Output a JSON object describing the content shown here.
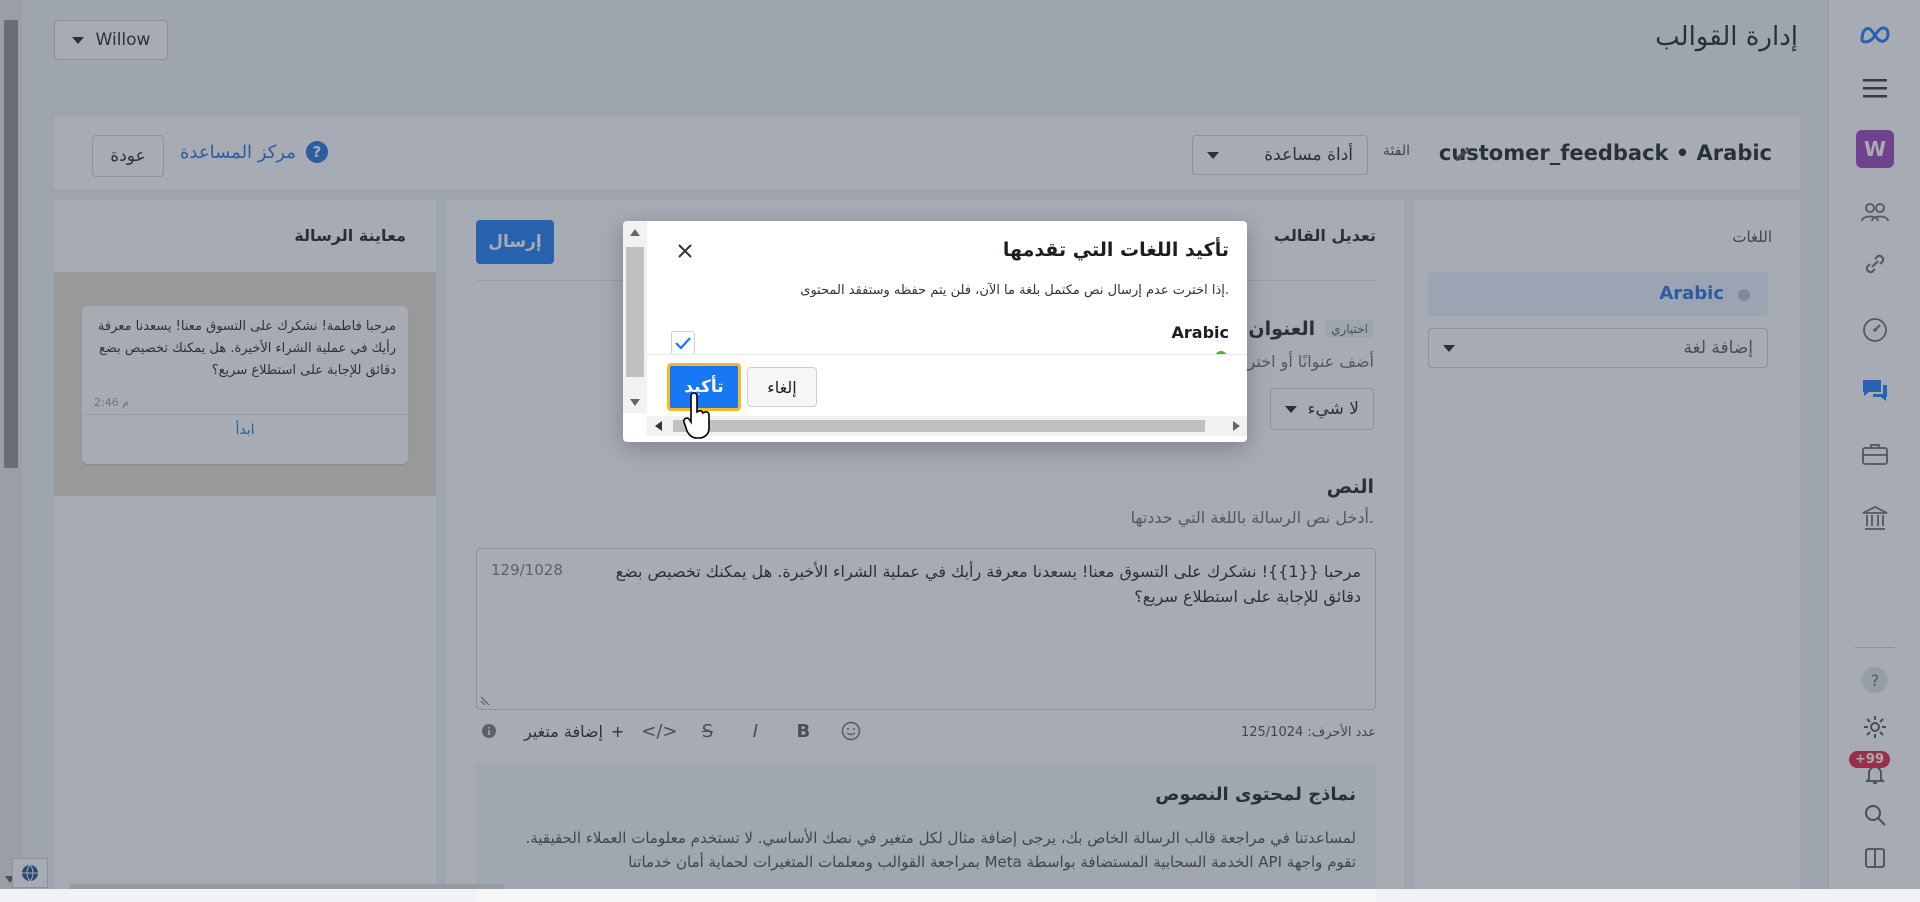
{
  "header": {
    "page_title": "إدارة القوالب",
    "account_name": "Willow"
  },
  "template_bar": {
    "template_name": "customer_feedback • Arabic",
    "category_label": "الفئة",
    "category_value": "أداة مساعدة",
    "help_center": "مركز المساعدة",
    "back": "عودة"
  },
  "languages": {
    "title": "اللغات",
    "selected": "Arabic",
    "add_placeholder": "إضافة لغة"
  },
  "editor": {
    "title": "تعديل القالب",
    "send": "إرسال",
    "header_label": "العنوان",
    "optional": "اختياري",
    "header_sub": "أضف عنوانًا أو اختر",
    "header_type": "لا شيء",
    "body_label": "النص",
    "body_sub": "أدخل نص الرسالة باللغة التي حددتها.",
    "body_text": "مرحبا {{1}}! نشكرك على التسوق معنا! يسعدنا معرفة رأيك في عملية الشراء الأخيرة. هل يمكنك تخصيص بضع دقائق للإجابة على استطلاع سريع؟",
    "body_count": "129/1028",
    "char_count": "عدد الأحرف: 125/1024",
    "add_variable": "إضافة متغير",
    "samples_title": "نماذج لمحتوى النصوص",
    "samples_text": "لمساعدتنا في مراجعة قالب الرسالة الخاص بك، يرجى إضافة مثال لكل متغير في نصك الأساسي. لا تستخدم معلومات العملاء الحقيقية. تقوم واجهة API الخدمة السحابية المستضافة بواسطة Meta بمراجعة القوالب ومعلمات المتغيرات لحماية أمان خدماتنا"
  },
  "preview": {
    "title": "معاينة الرسالة",
    "message": "مرحبا فاطمة! نشكرك على التسوق معنا! يسعدنا معرفة رأيك في عملية الشراء الأخيرة. هل يمكنك تخصيص بضع دقائق للإجابة على استطلاع سريع؟",
    "time": "2:46 م",
    "cta": "ابدأ"
  },
  "dialog": {
    "title": "تأكيد اللغات التي تقدمها",
    "description": "إذا اخترت عدم إرسال نص مكتمل بلغة ما الآن، فلن يتم حفظه وستفقد المحتوى.",
    "language": "Arabic",
    "confirm": "تأكيد",
    "cancel": "إلغاء"
  },
  "rail": {
    "avatar_letter": "W",
    "badge": "+99"
  },
  "icons": {
    "meta": "meta-logo-icon",
    "menu": "hamburger-menu-icon",
    "people": "people-icon",
    "link": "link-icon",
    "gauge": "gauge-icon",
    "chat": "chat-icon",
    "briefcase": "briefcase-icon",
    "bank": "bank-icon",
    "help": "help-icon",
    "settings": "gear-icon",
    "bell": "bell-icon",
    "search": "search-icon",
    "panel": "panel-icon"
  },
  "colors": {
    "accent": "#1877f2",
    "link": "#216fdb",
    "badge": "#e41e3f",
    "focus": "#f7b928",
    "avatar": "#9b3cb8"
  }
}
